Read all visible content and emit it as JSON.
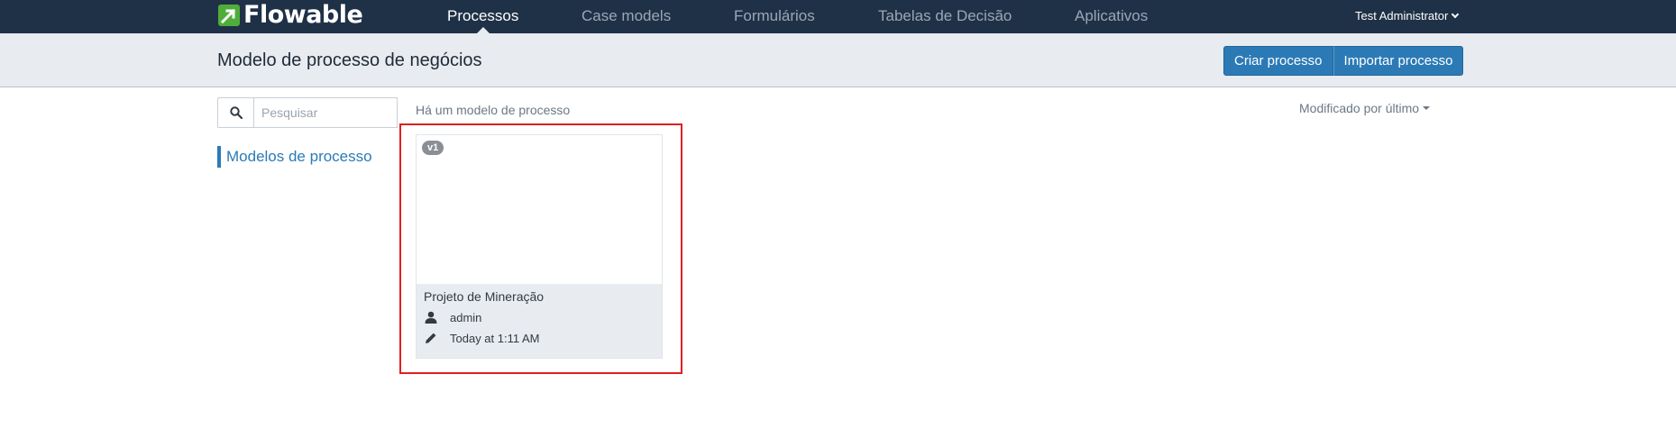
{
  "app": {
    "brand": "Flowable"
  },
  "nav": {
    "tabs": [
      {
        "label": "Processos",
        "active": true
      },
      {
        "label": "Case models",
        "active": false
      },
      {
        "label": "Formulários",
        "active": false
      },
      {
        "label": "Tabelas de Decisão",
        "active": false
      },
      {
        "label": "Aplicativos",
        "active": false
      }
    ],
    "user": "Test Administrator"
  },
  "header": {
    "title": "Modelo de processo de negócios",
    "create_label": "Criar processo",
    "import_label": "Importar processo"
  },
  "search": {
    "placeholder": "Pesquisar",
    "value": ""
  },
  "sidebar": {
    "items": [
      {
        "label": "Modelos de processo",
        "active": true
      }
    ]
  },
  "main": {
    "count_text": "Há um modelo de processo",
    "sort_label": "Modificado por último",
    "cards": [
      {
        "version": "v1",
        "name": "Projeto de Mineração",
        "author": "admin",
        "modified": "Today at 1:11 AM"
      }
    ]
  },
  "colors": {
    "navbar": "#1f3147",
    "accent": "#2b7ab6",
    "brand_green": "#4fae3a",
    "highlight": "#e02020"
  },
  "icons": [
    "flowable-logo-icon",
    "search-icon",
    "user-icon",
    "pencil-icon",
    "chevron-down-icon",
    "caret-down-icon"
  ]
}
